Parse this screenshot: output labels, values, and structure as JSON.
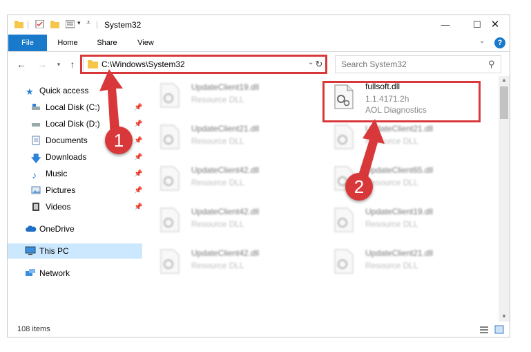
{
  "window": {
    "title": "System32"
  },
  "ribbon": {
    "tabs": [
      "File",
      "Home",
      "Share",
      "View"
    ]
  },
  "address": {
    "path": "C:\\Windows\\System32"
  },
  "search": {
    "placeholder": "Search System32"
  },
  "nav": {
    "items": [
      {
        "label": "Quick access"
      },
      {
        "label": "Local Disk (C:)"
      },
      {
        "label": "Local Disk (D:)"
      },
      {
        "label": "Documents"
      },
      {
        "label": "Downloads"
      },
      {
        "label": "Music"
      },
      {
        "label": "Pictures"
      },
      {
        "label": "Videos"
      },
      {
        "label": "OneDrive"
      },
      {
        "label": "This PC"
      },
      {
        "label": "Network"
      }
    ]
  },
  "files": {
    "highlighted": {
      "name": "fullsoft.dll",
      "version": "1.1.4171.2h",
      "company": "AOL Diagnostics"
    },
    "left_column": [
      {
        "name": "UpdateClient19.dll",
        "desc": "Resource DLL"
      },
      {
        "name": "UpdateClient21.dll",
        "desc": "Resource DLL"
      },
      {
        "name": "UpdateClient42.dll",
        "desc": "Resource DLL"
      },
      {
        "name": "UpdateClient42.dll",
        "desc": "Resource DLL"
      },
      {
        "name": "UpdateClient42.dll",
        "desc": "Resource DLL"
      }
    ],
    "right_column": [
      {
        "name": "UpdateClient21.dll",
        "desc": "Resource DLL"
      },
      {
        "name": "UpdateClient65.dll",
        "desc": "Resource DLL"
      },
      {
        "name": "UpdateClient19.dll",
        "desc": "Resource DLL"
      },
      {
        "name": "UpdateClient21.dll",
        "desc": "Resource DLL"
      }
    ]
  },
  "status": {
    "item_count": "108 items"
  },
  "annotations": {
    "step1": "1",
    "step2": "2",
    "color": "#d9383a"
  }
}
